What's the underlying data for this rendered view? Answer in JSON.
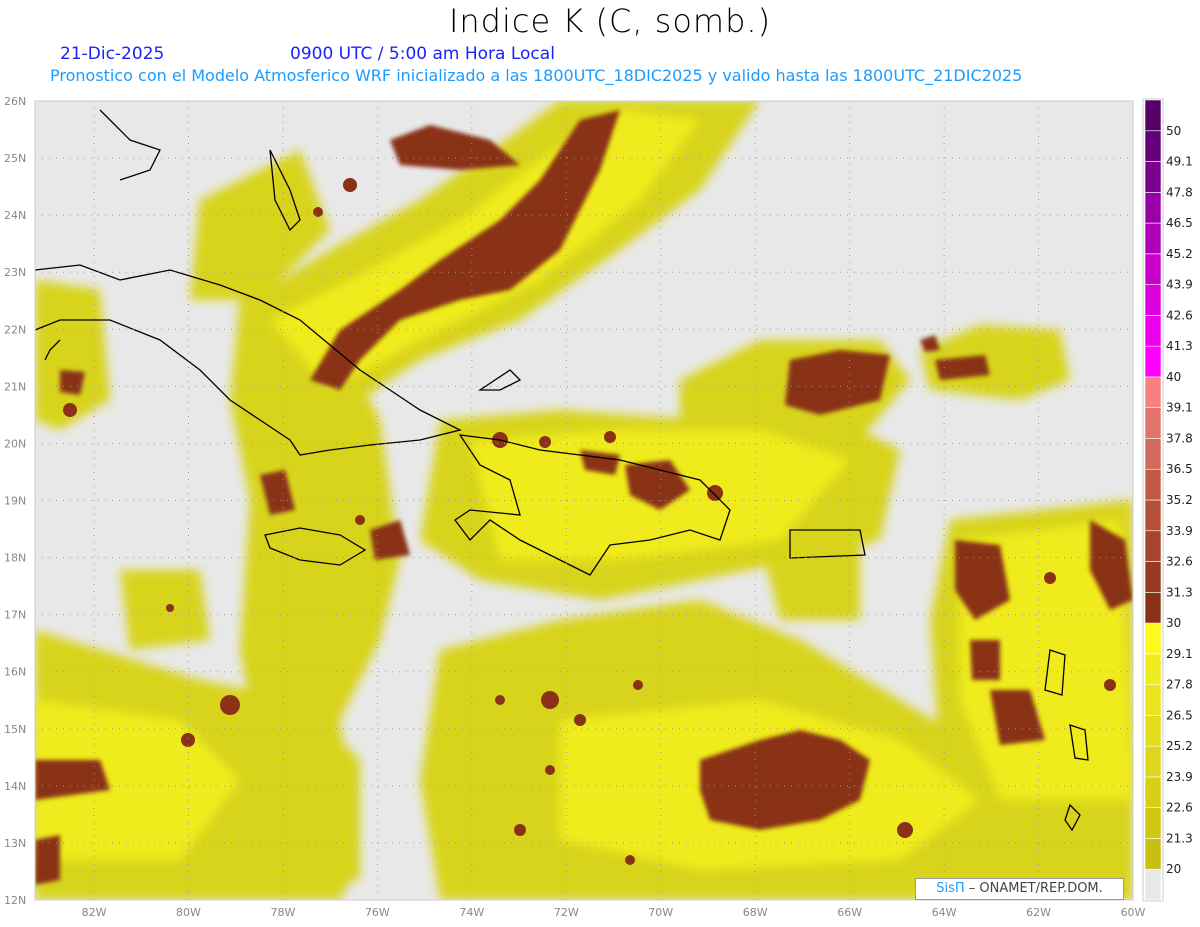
{
  "header": {
    "title": "Indice K (C, somb.)",
    "date": "21-Dic-2025",
    "time": "0900 UTC / 5:00 am Hora Local",
    "subtitle": "Pronostico con el Modelo Atmosferico WRF inicializado a las 1800UTC_18DIC2025 y valido hasta las  1800UTC_21DIC2025"
  },
  "map": {
    "lon_labels": [
      "82W",
      "80W",
      "78W",
      "76W",
      "74W",
      "72W",
      "70W",
      "68W",
      "66W",
      "64W",
      "62W",
      "60W"
    ],
    "lat_labels": [
      "26N",
      "25N",
      "24N",
      "23N",
      "22N",
      "21N",
      "20N",
      "19N",
      "18N",
      "17N",
      "16N",
      "15N",
      "14N",
      "13N",
      "12N"
    ],
    "lon_range": [
      -83.25,
      -60
    ],
    "lat_range": [
      12,
      26
    ],
    "grid": "dotted",
    "land_outline_color": "#000000",
    "missing_color": "#e8e8e8"
  },
  "colorbar": {
    "labels": [
      "20",
      "21.3",
      "22.6",
      "23.9",
      "25.2",
      "26.5",
      "27.8",
      "29.1",
      "30",
      "31.3",
      "32.6",
      "33.9",
      "35.2",
      "36.5",
      "37.8",
      "39.1",
      "40",
      "41.3",
      "42.6",
      "43.9",
      "45.2",
      "46.5",
      "47.8",
      "49.1",
      "50"
    ],
    "colors": [
      "#e8e8e8",
      "#c8c010",
      "#cfc813",
      "#d6d016",
      "#dcd719",
      "#e2de1b",
      "#e9e51d",
      "#f0ed1e",
      "#fafa1e",
      "#8a3218",
      "#983a22",
      "#a6452c",
      "#b45036",
      "#c05a44",
      "#d06a5c",
      "#e07468",
      "#f88080",
      "#ff00ff",
      "#ee00ee",
      "#dc00dc",
      "#c800c8",
      "#b000b8",
      "#9800a8",
      "#7c0090",
      "#640078",
      "#540064"
    ]
  },
  "logo": {
    "brand": "SisΠ",
    "text": "– ONAMET/REP.DOM."
  }
}
